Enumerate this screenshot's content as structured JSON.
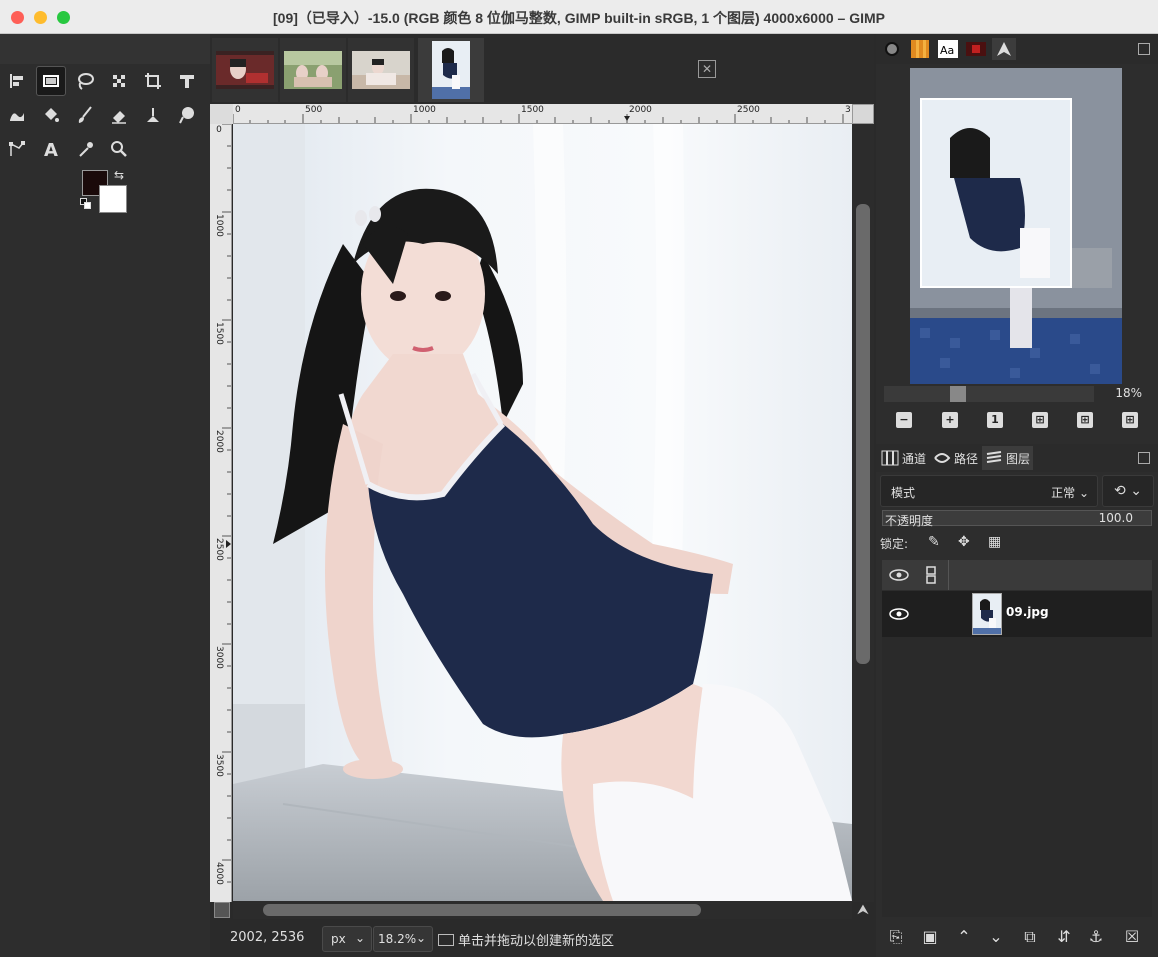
{
  "window": {
    "title": "[09]（已导入）-15.0 (RGB 颜色 8 位伽马整数, GIMP built-in sRGB, 1 个图层) 4000x6000 – GIMP"
  },
  "toolbox": {
    "tools": [
      "align-tool",
      "rect-select-tool",
      "free-select-tool",
      "fuzzy-select-tool",
      "crop-tool",
      "transform-tool",
      "warp-tool",
      "bucket-fill-tool",
      "paintbrush-tool",
      "eraser-tool",
      "clone-tool",
      "smudge-tool",
      "paths-tool",
      "text-tool",
      "color-picker-tool",
      "zoom-tool"
    ],
    "active_tool": "rect-select-tool",
    "fg_color": "#1a0a0a",
    "bg_color": "#ffffff"
  },
  "rulers": {
    "top_labels": [
      "0",
      "500",
      "1000",
      "1500",
      "2000",
      "2500",
      "3"
    ],
    "left_labels": [
      "0",
      "1000",
      "1500",
      "2000",
      "2500",
      "3000",
      "3500",
      "4000"
    ]
  },
  "status": {
    "coords": "2002, 2536",
    "unit": "px",
    "zoom": "18.2%",
    "message": "单击并拖动以创建新的选区"
  },
  "navigator": {
    "zoom_label": "18%"
  },
  "layers_dock": {
    "tabs": [
      {
        "label": "通道"
      },
      {
        "label": "路径"
      },
      {
        "label": "图层"
      }
    ],
    "mode_label": "模式",
    "mode_value": "正常",
    "opacity_label": "不透明度",
    "opacity_value": "100.0",
    "lock_label": "锁定:",
    "layer_name": "09.jpg"
  },
  "colors": {
    "accent_swimsuit": "#1e2a4a",
    "bg_dark": "#2d2d2d"
  }
}
